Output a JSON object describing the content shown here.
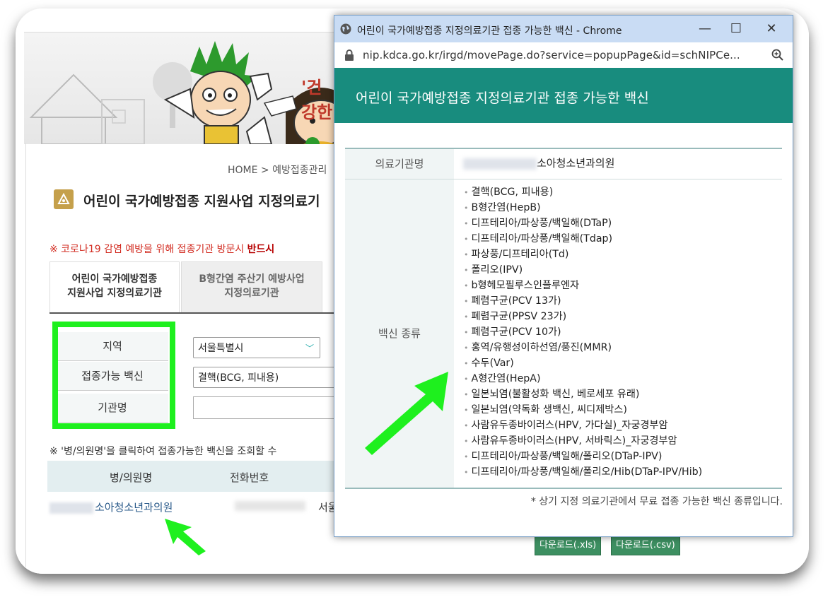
{
  "background_page": {
    "slogan": "'건강한",
    "breadcrumb": "HOME > 예방접종관리",
    "title": "어린이 국가예방접종 지원사업 지정의료기",
    "notice_prefix": "※ 코로나19 감염 예방을 위해 접종기관 방문시",
    "notice_bold": "반드시",
    "tabs": [
      {
        "line1": "어린이 국가예방접종",
        "line2": "지원사업 지정의료기관"
      },
      {
        "line1": "B형간염 주산기 예방사업",
        "line2": "지정의료기관"
      }
    ],
    "form": {
      "region_label": "지역",
      "region_value": "서울특별시",
      "vaccine_label": "접종가능 백신",
      "vaccine_value": "결핵(BCG, 피내용)",
      "institution_label": "기관명",
      "institution_value": ""
    },
    "hint": "※ '병/의원명'을 클릭하여 접종가능한 백신을 조회할 수",
    "results": {
      "col_name": "병/의원명",
      "col_phone": "전화번호",
      "row_name": "소아청소년과의원",
      "row_addr": "서울"
    },
    "download_xls": "다운로드(.xls)",
    "download_csv": "다운로드(.csv)"
  },
  "popup": {
    "window_title": "어린이 국가예방접종 지정의료기관 접종 가능한 백신 - Chrome",
    "url": "nip.kdca.go.kr/irgd/movePage.do?service=popupPage&id=schNIPCe...",
    "header": "어린이 국가예방접종 지정의료기관 접종 가능한 백신",
    "institution_label": "의료기관명",
    "institution_value": "소아청소년과의원",
    "vaccine_label": "백신 종류",
    "vaccines": [
      "결핵(BCG, 피내용)",
      "B형간염(HepB)",
      "디프테리아/파상풍/백일해(DTaP)",
      "디프테리아/파상풍/백일해(Tdap)",
      "파상풍/디프테리아(Td)",
      "폴리오(IPV)",
      "b형헤모필루스인플루엔자",
      "폐렴구균(PCV 13가)",
      "폐렴구균(PPSV 23가)",
      "폐렴구균(PCV 10가)",
      "홍역/유행성이하선염/풍진(MMR)",
      "수두(Var)",
      "A형간염(HepA)",
      "일본뇌염(불활성화 백신, 베로세포 유래)",
      "일본뇌염(약독화 생백신, 씨디제박스)",
      "사람유두종바이러스(HPV, 가다실)_자궁경부암",
      "사람유두종바이러스(HPV, 서바릭스)_자궁경부암",
      "디프테리아/파상풍/백일해/폴리오(DTaP-IPV)",
      "디프테리아/파상풍/백일해/폴리오/Hib(DTaP-IPV/Hib)"
    ],
    "footnote": "* 상기 지정 의료기관에서 무료 접종 가능한 백신 종류입니다."
  },
  "colors": {
    "popup_header": "#188c7e",
    "highlight": "#1ef01e",
    "titlebar": "#c9dcf4",
    "download_button": "#3d8f61"
  },
  "icons": [
    "globe-icon",
    "lock-icon",
    "zoom-icon",
    "minimize-icon",
    "maximize-icon",
    "close-icon",
    "chevron-down-icon",
    "arrow-annotation"
  ]
}
